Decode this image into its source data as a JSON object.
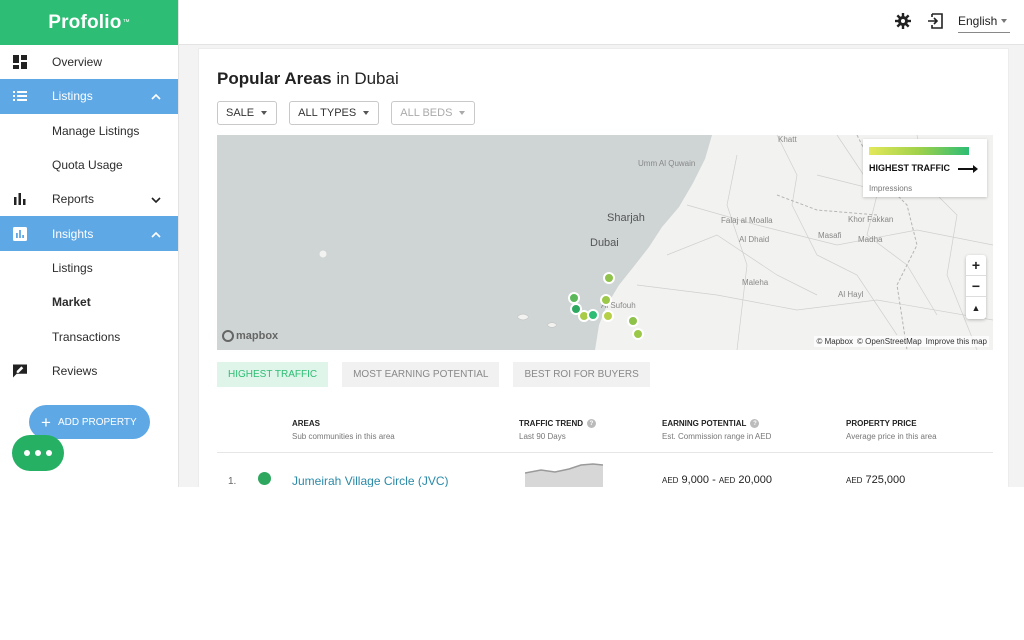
{
  "brand": {
    "name": "Profolio",
    "tm": "™"
  },
  "sidebar": {
    "items": [
      {
        "label": "Overview"
      },
      {
        "label": "Listings"
      },
      {
        "label": "Manage Listings"
      },
      {
        "label": "Quota Usage"
      },
      {
        "label": "Reports"
      },
      {
        "label": "Insights"
      },
      {
        "label": "Listings"
      },
      {
        "label": "Market"
      },
      {
        "label": "Transactions"
      },
      {
        "label": "Reviews"
      }
    ],
    "add_property": "ADD PROPERTY"
  },
  "topbar": {
    "language": "English"
  },
  "page": {
    "title_bold": "Popular Areas",
    "title_rest": " in Dubai"
  },
  "filters": {
    "sale": "SALE",
    "types": "ALL TYPES",
    "beds": "ALL BEDS"
  },
  "map": {
    "labels": {
      "khatt": "Khatt",
      "umm_al_quwain": "Umm Al Quwain",
      "sharjah": "Sharjah",
      "dubai": "Dubai",
      "falaj": "Falaj al Moalla",
      "al_dhaid": "Al Dhaid",
      "masafi": "Masafi",
      "khor_fakkan": "Khor Fakkan",
      "madha": "Madha",
      "maleha": "Maleha",
      "al_hayl": "Al Hayl",
      "al_sufouh": "Al Sufouh"
    },
    "legend": {
      "title": "HIGHEST TRAFFIC",
      "subtitle": "Impressions"
    },
    "zoom_in": "+",
    "zoom_out": "−",
    "compass": "▲",
    "logo": "mapbox",
    "attribution": {
      "mapbox": "© Mapbox",
      "osm": "© OpenStreetMap",
      "improve": "Improve this map"
    }
  },
  "tabs": {
    "highest_traffic": "HIGHEST TRAFFIC",
    "earning": "MOST EARNING POTENTIAL",
    "roi": "BEST ROI FOR BUYERS"
  },
  "table": {
    "headers": {
      "areas": "AREAS",
      "areas_sub": "Sub communities in this area",
      "trend": "TRAFFIC TREND",
      "trend_sub": "Last 90 Days",
      "earning": "EARNING POTENTIAL",
      "earning_sub": "Est. Commission range in AED",
      "price": "PROPERTY PRICE",
      "price_sub": "Average price in this area"
    },
    "rows": [
      {
        "num": "1.",
        "area": "Jumeirah Village Circle (JVC)",
        "earn_cur1": "AED",
        "earn_min": "9,000",
        "earn_sep": " - ",
        "earn_cur2": "AED",
        "earn_max": "20,000",
        "price_cur": "AED",
        "price": "725,000"
      }
    ]
  },
  "colors": {
    "brand": "#2dbd74",
    "active_nav": "#5fa8e6",
    "link": "#2a8aa8"
  }
}
